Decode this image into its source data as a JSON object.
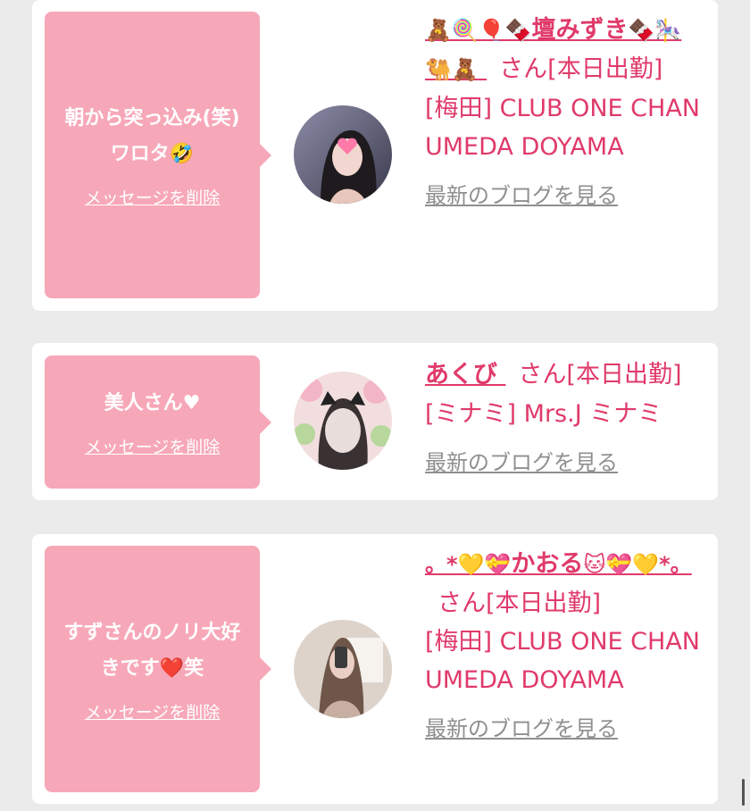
{
  "entries": [
    {
      "message": "朝から突っ込み(笑)ワロタ🤣",
      "delete_label": "メッセージを削除",
      "name_emoji_prefix": "🧸🍭🎈🍫",
      "name": "壇みずき",
      "name_emoji_suffix": "🍫🎠🐫🧸",
      "suffix": "さん[本日出勤]",
      "shop": "[梅田] CLUB ONE CHAN UMEDA DOYAMA",
      "blog_label": "最新のブログを見る",
      "colors": {
        "bg1": "#2b2b3a",
        "bg2": "#6b6b86"
      }
    },
    {
      "message": "美人さん♥",
      "delete_label": "メッセージを削除",
      "name_emoji_prefix": "",
      "name": "あくび",
      "name_emoji_suffix": "",
      "suffix": "さん[本日出勤]",
      "shop": "[ミナミ] Mrs.J ミナミ",
      "blog_label": "最新のブログを見る",
      "colors": {
        "bg1": "#f3d8d8",
        "bg2": "#b7d39b"
      }
    },
    {
      "message": "すずさんのノリ大好きです❤️笑",
      "delete_label": "メッセージを削除",
      "name_emoji_prefix": "。*💛💝",
      "name": "かおる",
      "name_emoji_suffix": "🐱💝💛*。",
      "suffix": "さん[本日出勤]",
      "shop": "[梅田] CLUB ONE CHAN UMEDA DOYAMA",
      "blog_label": "最新のブログを見る",
      "colors": {
        "bg1": "#d9cfc6",
        "bg2": "#8a6f5e"
      }
    }
  ]
}
